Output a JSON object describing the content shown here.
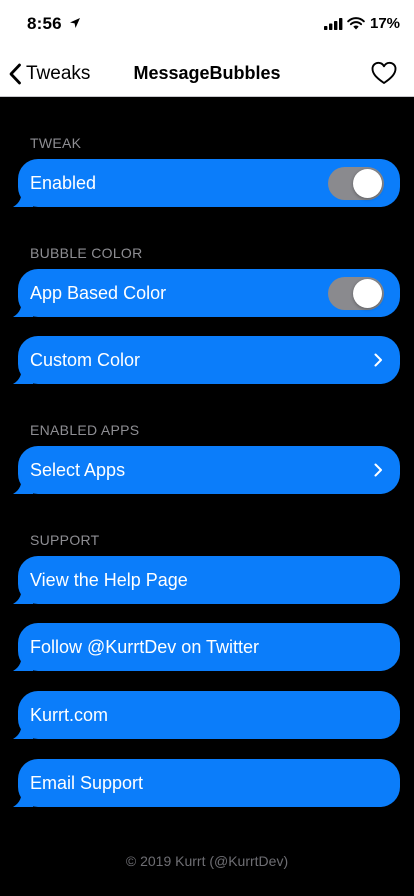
{
  "status_bar": {
    "time": "8:56",
    "battery": "17%"
  },
  "nav": {
    "back_label": "Tweaks",
    "title": "MessageBubbles"
  },
  "sections": [
    {
      "header": "TWEAK",
      "items": [
        {
          "label": "Enabled",
          "control": "toggle",
          "on": true
        }
      ]
    },
    {
      "header": "BUBBLE COLOR",
      "items": [
        {
          "label": "App Based Color",
          "control": "toggle",
          "on": true
        },
        {
          "label": "Custom Color",
          "control": "chevron"
        }
      ]
    },
    {
      "header": "ENABLED APPS",
      "items": [
        {
          "label": "Select Apps",
          "control": "chevron"
        }
      ]
    },
    {
      "header": "SUPPORT",
      "items": [
        {
          "label": "View the Help Page",
          "control": "none"
        },
        {
          "label": "Follow @KurrtDev on Twitter",
          "control": "none"
        },
        {
          "label": "Kurrt.com",
          "control": "none"
        },
        {
          "label": "Email Support",
          "control": "none"
        }
      ]
    }
  ],
  "footer": "© 2019 Kurrt (@KurrtDev)",
  "colors": {
    "bubble": "#0b7dfa",
    "background": "#000000",
    "toggle_track": "#8a8a8e",
    "section_header": "#8e8e93"
  }
}
